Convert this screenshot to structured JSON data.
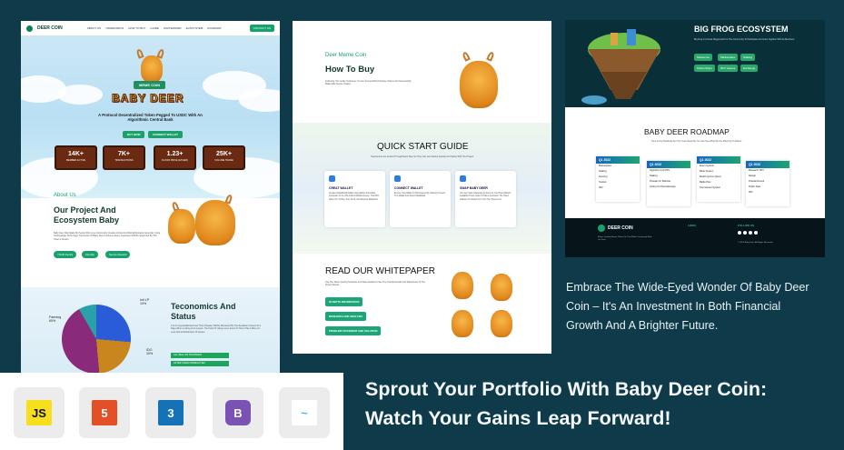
{
  "panel1": {
    "nav": {
      "brand": "DEER COIN",
      "links": [
        "ABOUT US",
        "TOKENOMICS",
        "HOW TO BUY",
        "GUIDE",
        "WHITEPAPER",
        "ECOSYSTEM",
        "ROADMAP"
      ],
      "contact": "CONTACT US"
    },
    "hero": {
      "badge": "MEME COIN",
      "title": "BABY DEER",
      "tagline_1": "A Protocol Decentralized Token Pegged To USDC With An",
      "tagline_2": "Algorithmic Central Bank",
      "buy_button": "BUY NOW",
      "wallet_button": "CONNECT WALLET"
    },
    "stats": [
      {
        "value": "14K+",
        "label": "MEMBER ACTIVE"
      },
      {
        "value": "7K+",
        "label": "TRANSACTIONS"
      },
      {
        "value": "1.23+",
        "label": "FLOOR PRICE (ETHER)"
      },
      {
        "value": "25K+",
        "label": "VOLUME TRADE"
      }
    ],
    "about": {
      "eyebrow": "About Us",
      "title_1": "Our Project And",
      "title_2": "Ecosystem Baby",
      "body": "Baby Deer Was Made By People Who Love Community Creative Artists And Web Enthusiasts, Everyday Using Cutting-Edge Technology. The Dream Of Baby Deer Continues Every Investment Will Be Supported By This Token's Growth.",
      "pills": [
        "YOUR Family",
        "Friendly",
        "Secure Reward"
      ]
    },
    "tokenomics": {
      "title_1": "Teconomics And",
      "title_2": "Status",
      "body": "It Is A Long Established Fact That A Reader Will Be Distracted By The Readable Content Of A Page When Looking At Its Layout. The Point Of Using Lorem Ipsum Is That It Has A More-Or-Less Normal Distribution Of Letters.",
      "label_lp": "Init LP",
      "pct_lp": "10%",
      "label_farming": "Farming",
      "pct_farming": "60%",
      "label_ido": "IDO",
      "pct_ido": "10%",
      "bar_1": "ALL SELL OR TRANSFER",
      "bar_2": "AFTER FIXED FORMALITIES"
    }
  },
  "panel2": {
    "eyebrow": "Deer Meme Coin",
    "title": "How To Buy",
    "body": "Following Your Guide To Ensure You Are Successfully Purchase Tokens And Successfully Make Safe Secure Trades.",
    "quick_title": "QUICK START GUIDE",
    "quick_body": "Newcomers Are Guided Through Each Step So They Can Get Started Quickly And Safely With The Project.",
    "cards": [
      {
        "title": "CREAT WALLET",
        "body": "Create A MetaMask Wallet Using Either A Desktop Computer Or An iOS Android Mobile Device. That Will Allow You To Buy, Sell, Send, And Receive BabyDeer."
      },
      {
        "title": "CONNECT WALLET",
        "body": "Ensure Your Wallet To Fill Finance By Clicking Connect To A Wallet And Select MetaMask."
      },
      {
        "title": "SWAP BABY DEER",
        "body": "You Can Start Swapping As Soon As You Have ERC20 Available! Press Select A Token And Enter The Token Address Or Search For It On The Tokens List."
      }
    ],
    "white_title": "READ OUR WHITEPAPER",
    "white_body": "Use The Token Vesting Schedule And Sales Details To See The Overall Growth And Tokenomics Of The Project Ahead.",
    "white_buttons": [
      "IN DEPTH INFORMATION",
      "RESEARCH AND ANALYSIS",
      "PROBLEM STATEMENT AND SOLUTION"
    ]
  },
  "panel3": {
    "eco_title": "BIG FROG ECOSYSTEM",
    "eco_body": "Big Frog Is A Great Playground For The Community To Participate And Grow Together With Its Members.",
    "eco_buttons": [
      "Metaverse",
      "Marketplace",
      "Staking",
      "Partnerships",
      "NFT Games",
      "Exchange"
    ],
    "roadmap_title": "BABY DEER ROADMAP",
    "roadmap_body": "Here Is Our Roadmap For The Year Ahead So You Can See What We Are Planning To Deliver.",
    "quarters": [
      {
        "label": "Q1 2022",
        "items": [
          "Marketplace",
          "Staking",
          "Farming",
          "Testnet",
          "IDO"
        ]
      },
      {
        "label": "Q1 2022",
        "items": [
          "Algorithm Full DVS",
          "Staking",
          "Presale On Website",
          "Listing On Pancakeswap"
        ]
      },
      {
        "label": "Q1 2022",
        "items": [
          "Event System",
          "Bank System",
          "Build Improve Quest",
          "Battle Plan",
          "Tournament System"
        ]
      },
      {
        "label": "Q1 2022",
        "items": [
          "Research NFT",
          "Design",
          "Presale Round",
          "Public Sale",
          "IDO"
        ]
      }
    ],
    "footer_brand": "DEER COIN",
    "footer_links_title": "LINKS",
    "footer_follow_title": "FOLLOW US",
    "footer_body": "A Fun, Leading Meme Token For The Whole Community Built On Trust.",
    "footer_copy": "© 2024 Baby Deer. All Rights Reserved."
  },
  "marketing": {
    "description": "Embrace The Wide-Eyed Wonder Of Baby Deer Coin – It's An Investment In Both Financial Growth And A Brighter Future.",
    "headline": "Sprout Your Portfolio With Baby Deer Coin: Watch Your Gains Leap Forward!"
  },
  "tech_stack": [
    {
      "name": "JS",
      "icon": "javascript-icon",
      "bg": "#f7df1e",
      "color": "#111"
    },
    {
      "name": "5",
      "icon": "html5-icon",
      "bg": "#e34f26",
      "color": "#fff"
    },
    {
      "name": "3",
      "icon": "css3-icon",
      "bg": "#1572b6",
      "color": "#fff"
    },
    {
      "name": "B",
      "icon": "bootstrap-icon",
      "bg": "#7952b3",
      "color": "#fff"
    },
    {
      "name": "~",
      "icon": "tailwind-icon",
      "bg": "#ffffff",
      "color": "#38bdf8"
    }
  ]
}
